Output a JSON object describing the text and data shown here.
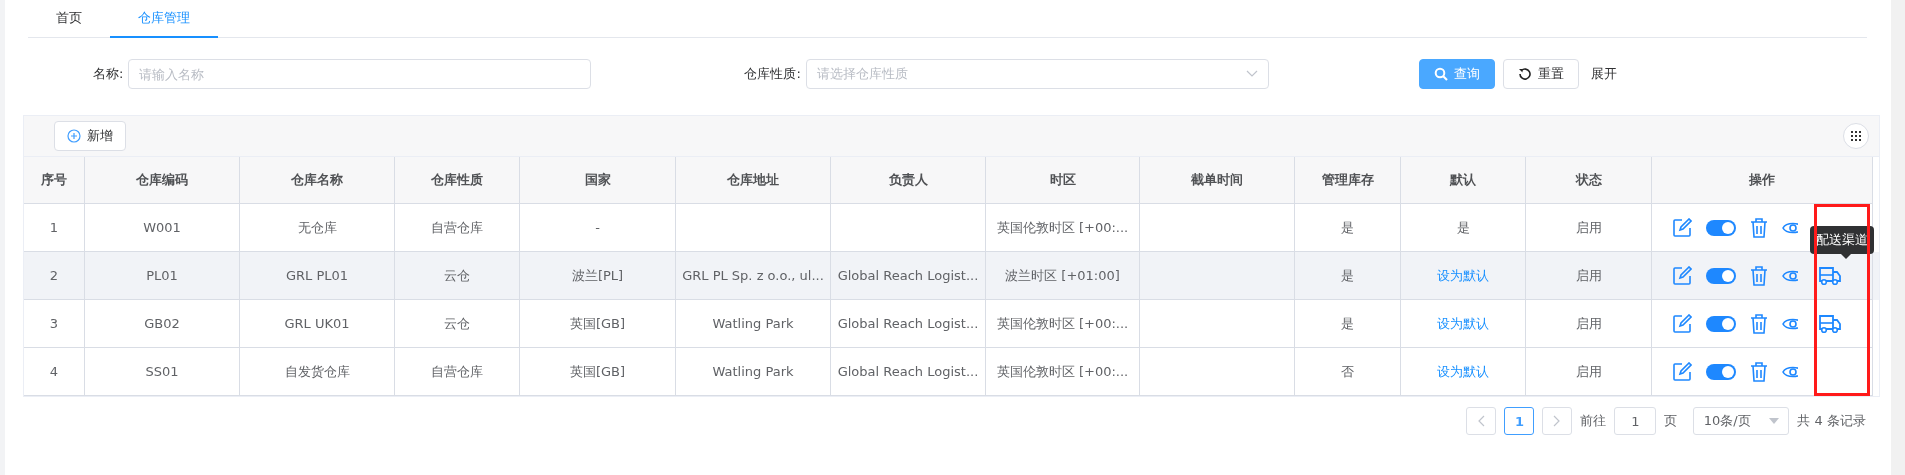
{
  "tabs": [
    {
      "label": "首页",
      "selected": false
    },
    {
      "label": "仓库管理",
      "selected": true
    }
  ],
  "filters": [
    {
      "label": "名称:",
      "placeholder": "请输入名称",
      "kind": "input"
    },
    {
      "label": "仓库性质:",
      "placeholder": "请选择仓库性质",
      "kind": "select"
    }
  ],
  "search_button": "查询",
  "reset_button": "重置",
  "expand_link": "展开",
  "add_button": "新增",
  "table": {
    "columns": [
      "序号",
      "仓库编码",
      "仓库名称",
      "仓库性质",
      "国家",
      "仓库地址",
      "负责人",
      "时区",
      "截单时间",
      "管理库存",
      "默认",
      "状态",
      "操作"
    ],
    "rows": [
      {
        "cells": [
          "1",
          "W001",
          "无仓库",
          "自营仓库",
          "-",
          "",
          "",
          "英国伦敦时区 [+00:...",
          "",
          "是"
        ],
        "default": {
          "text": "是",
          "kind": "text"
        },
        "status": "启用",
        "hovered": false,
        "enabled": true,
        "channel": false
      },
      {
        "cells": [
          "2",
          "PL01",
          "GRL PL01",
          "云仓",
          "波兰[PL]",
          "GRL PL Sp. z o.o., ul...",
          "Global Reach Logist...",
          "波兰时区 [+01:00]",
          "",
          "是"
        ],
        "default": {
          "text": "设为默认",
          "kind": "link"
        },
        "status": "启用",
        "hovered": true,
        "enabled": true,
        "channel": true
      },
      {
        "cells": [
          "3",
          "GB02",
          "GRL UK01",
          "云仓",
          "英国[GB]",
          "Watling Park",
          "Global Reach Logist...",
          "英国伦敦时区 [+00:...",
          "",
          "是"
        ],
        "default": {
          "text": "设为默认",
          "kind": "link"
        },
        "status": "启用",
        "hovered": false,
        "enabled": true,
        "channel": true
      },
      {
        "cells": [
          "4",
          "SS01",
          "自发货仓库",
          "自营仓库",
          "英国[GB]",
          "Watling Park",
          "Global Reach Logist...",
          "英国伦敦时区 [+00:...",
          "",
          "否"
        ],
        "default": {
          "text": "设为默认",
          "kind": "link"
        },
        "status": "启用",
        "hovered": false,
        "enabled": true,
        "channel": false
      }
    ]
  },
  "tooltip": "配送渠道",
  "pagination": {
    "pages": [
      {
        "label": "1",
        "selected": true
      }
    ],
    "goto_label": "前往",
    "goto_value": "1",
    "page_unit": "页",
    "page_size": "10条/页",
    "total": "共 4 条记录"
  }
}
